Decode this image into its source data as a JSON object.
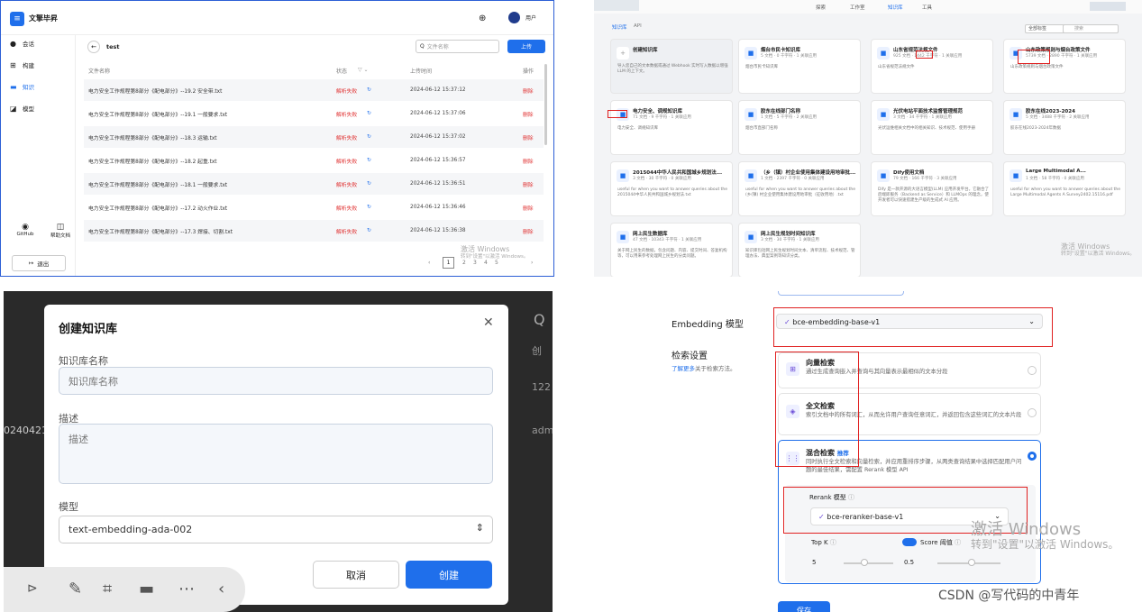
{
  "q1": {
    "brand": "文擎毕昇",
    "user": "用户",
    "nav": [
      "会话",
      "构建",
      "知识",
      "模型"
    ],
    "github": "GitHub",
    "help": "帮助文档",
    "logout": "退出",
    "title": "test",
    "search_placeholder": "文件名称",
    "upload": "上传",
    "headers": {
      "name": "文件名称",
      "status": "状态",
      "time": "上传时间",
      "op": "操作"
    },
    "rows": [
      {
        "name": "电力安全工作规程第8部分《配电部分》--19.2 安全带.txt",
        "status": "解析失败",
        "time": "2024-06-12 15:37:12",
        "op": "删除"
      },
      {
        "name": "电力安全工作规程第8部分《配电部分》--19.1 一般要求.txt",
        "status": "解析失败",
        "time": "2024-06-12 15:37:06",
        "op": "删除"
      },
      {
        "name": "电力安全工作规程第8部分《配电部分》--18.3 运输.txt",
        "status": "解析失败",
        "time": "2024-06-12 15:37:02",
        "op": "删除"
      },
      {
        "name": "电力安全工作规程第8部分《配电部分》--18.2 起重.txt",
        "status": "解析失败",
        "time": "2024-06-12 15:36:57",
        "op": "删除"
      },
      {
        "name": "电力安全工作规程第8部分《配电部分》--18.1 一般要求.txt",
        "status": "解析失败",
        "time": "2024-06-12 15:36:51",
        "op": "删除"
      },
      {
        "name": "电力安全工作规程第8部分《配电部分》--17.2 动火作业.txt",
        "status": "解析失败",
        "time": "2024-06-12 15:36:46",
        "op": "删除"
      },
      {
        "name": "电力安全工作规程第8部分《配电部分》--17.3 焊接、切割.txt",
        "status": "解析失败",
        "time": "2024-06-12 15:36:38",
        "op": "删除"
      }
    ],
    "pages": [
      "1",
      "2",
      "3",
      "4",
      "5"
    ],
    "watermark1": "激活 Windows",
    "watermark2": "转到\"设置\"以激活 Windows。"
  },
  "q2": {
    "nav": [
      "探索",
      "工作室",
      "知识库",
      "工具"
    ],
    "tabs": [
      "知识库",
      "API"
    ],
    "tag_filter": "全部标签",
    "search": "搜索",
    "create_title": "创建知识库",
    "create_desc": "导入您自己的文本数据或通过 Webhook 实时写入数据以增强 LLM 的上下文。",
    "cards": [
      {
        "title": "烟台市民卡知识库",
        "meta": "5 文档 · 0 千字符 · 1 关联应用",
        "desc": "烟台市民卡知识库"
      },
      {
        "title": "山东省规范法规文件",
        "meta": "925 文档 · 1442 千字符 · 1 关联应用",
        "desc": "山东省规范法规文件"
      },
      {
        "title": "山东政策规则与烟台政策文件",
        "meta": "5739 文档 · 2890 千字符 · 1 关联应用",
        "desc": "山东政策规则与烟台政策文件"
      },
      {
        "title": "电力安全、调规知识库",
        "meta": "71 文档 · 9 千字符 · 1 关联应用",
        "desc": "电力安全、调规知识库"
      },
      {
        "title": "胶东在线部门名称",
        "meta": "1 文档 · 5 千字符 · 2 关联应用",
        "desc": "烟台市直部门名称"
      },
      {
        "title": "光伏电站平面技术监督管理规范",
        "meta": "3 文档 · 34 千字符 · 1 关联应用",
        "desc": "光伏运维相关文档中的相关知识、技术规范、使用手册"
      },
      {
        "title": "胶东在线2023-2024",
        "meta": "5 文档 · 3488 千字符 · 2 关联应用",
        "desc": "胶东在线2023-2024年数据"
      },
      {
        "title": "2015044中华人民共和国城乡规划法...",
        "meta": "3 文档 · 30 千字符 · 0 关联应用",
        "desc": "useful for when you want to answer queries about the 2015044中华人民共和国城乡规划法.txt"
      },
      {
        "title": "（乡（镇）村企业使用集体建设用地审批...",
        "meta": "1 文档 · 2397 千字符 · 0 关联应用",
        "desc": "useful for when you want to answer queries about the (乡(镇) 村企业使用集体建设用地审批（征收用地）.txt"
      },
      {
        "title": "Dify使用文档",
        "meta": "79 文档 · 166 千字符 · 3 关联应用",
        "desc": "Dify 是一款开源的大语言模型(LLM) 应用开发平台。它融合了后端即服务（Backend as Service）和 LLMOps 的理念，使开发者可以快速搭建生产级的生成式 AI 应用。"
      },
      {
        "title": "Large Multimodal A...",
        "meta": "1 文档 · 58 千字符 · 0 关联应用",
        "desc": "useful for when you want to answer queries about the Large Multimodal Agents A Survey2402.15116.pdf"
      },
      {
        "title": "网上民生数据库",
        "meta": "47 文档 · 10343 千字符 · 1 关联应用",
        "desc": "关于网上民生的数据，包含问题、内容、提交时间、答复机构等，可以用来参考处理网上民生的分类问题。"
      },
      {
        "title": "网上民生规划时间知识库",
        "meta": "3 文档 · 30 千字符 · 1 关联应用",
        "desc": "知识库包括网上民生规划时间文本、清单流程、技术规范、管理办法、典型案例等知识分类。"
      }
    ],
    "watermark1": "激活 Windows",
    "watermark2": "转到\"设置\"以激活 Windows。"
  },
  "q3": {
    "title": "创建知识库",
    "name_label": "知识库名称",
    "name_placeholder": "知识库名称",
    "desc_label": "描述",
    "desc_placeholder": "描述",
    "model_label": "模型",
    "model_value": "text-embedding-ada-002",
    "cancel": "取消",
    "create": "创建",
    "bg_left": "0240421",
    "bg_right1": "创",
    "bg_right2": "122",
    "bg_right3": "adm"
  },
  "q4": {
    "embedding_label": "Embedding 模型",
    "embedding_value": "bce-embedding-base-v1",
    "retrieval_label": "检索设置",
    "learn_more": "了解更多",
    "learn_more_suffix": "关于检索方法。",
    "options": [
      {
        "title": "向量检索",
        "desc": "通过生成查询嵌入并查询与其向量表示最相似的文本分段"
      },
      {
        "title": "全文检索",
        "desc": "索引文档中的所有词汇，从而允许用户查询任意词汇，并返回包含这些词汇的文本片段"
      },
      {
        "title": "混合检索",
        "badge": "推荐",
        "desc": "同时执行全文检索和向量检索，并应用重排序步骤，从两类查询结果中选择匹配用户问题的最佳结果，需配置 Rerank 模型 API"
      }
    ],
    "rerank_label": "Rerank 模型",
    "rerank_value": "bce-reranker-base-v1",
    "topk_label": "Top K",
    "topk_value": "5",
    "score_label": "Score 阈值",
    "score_value": "0.5",
    "save": "保存",
    "watermark1": "激活 Windows",
    "watermark2": "转到\"设置\"以激活 Windows。"
  },
  "footer": "CSDN @写代码的中青年"
}
